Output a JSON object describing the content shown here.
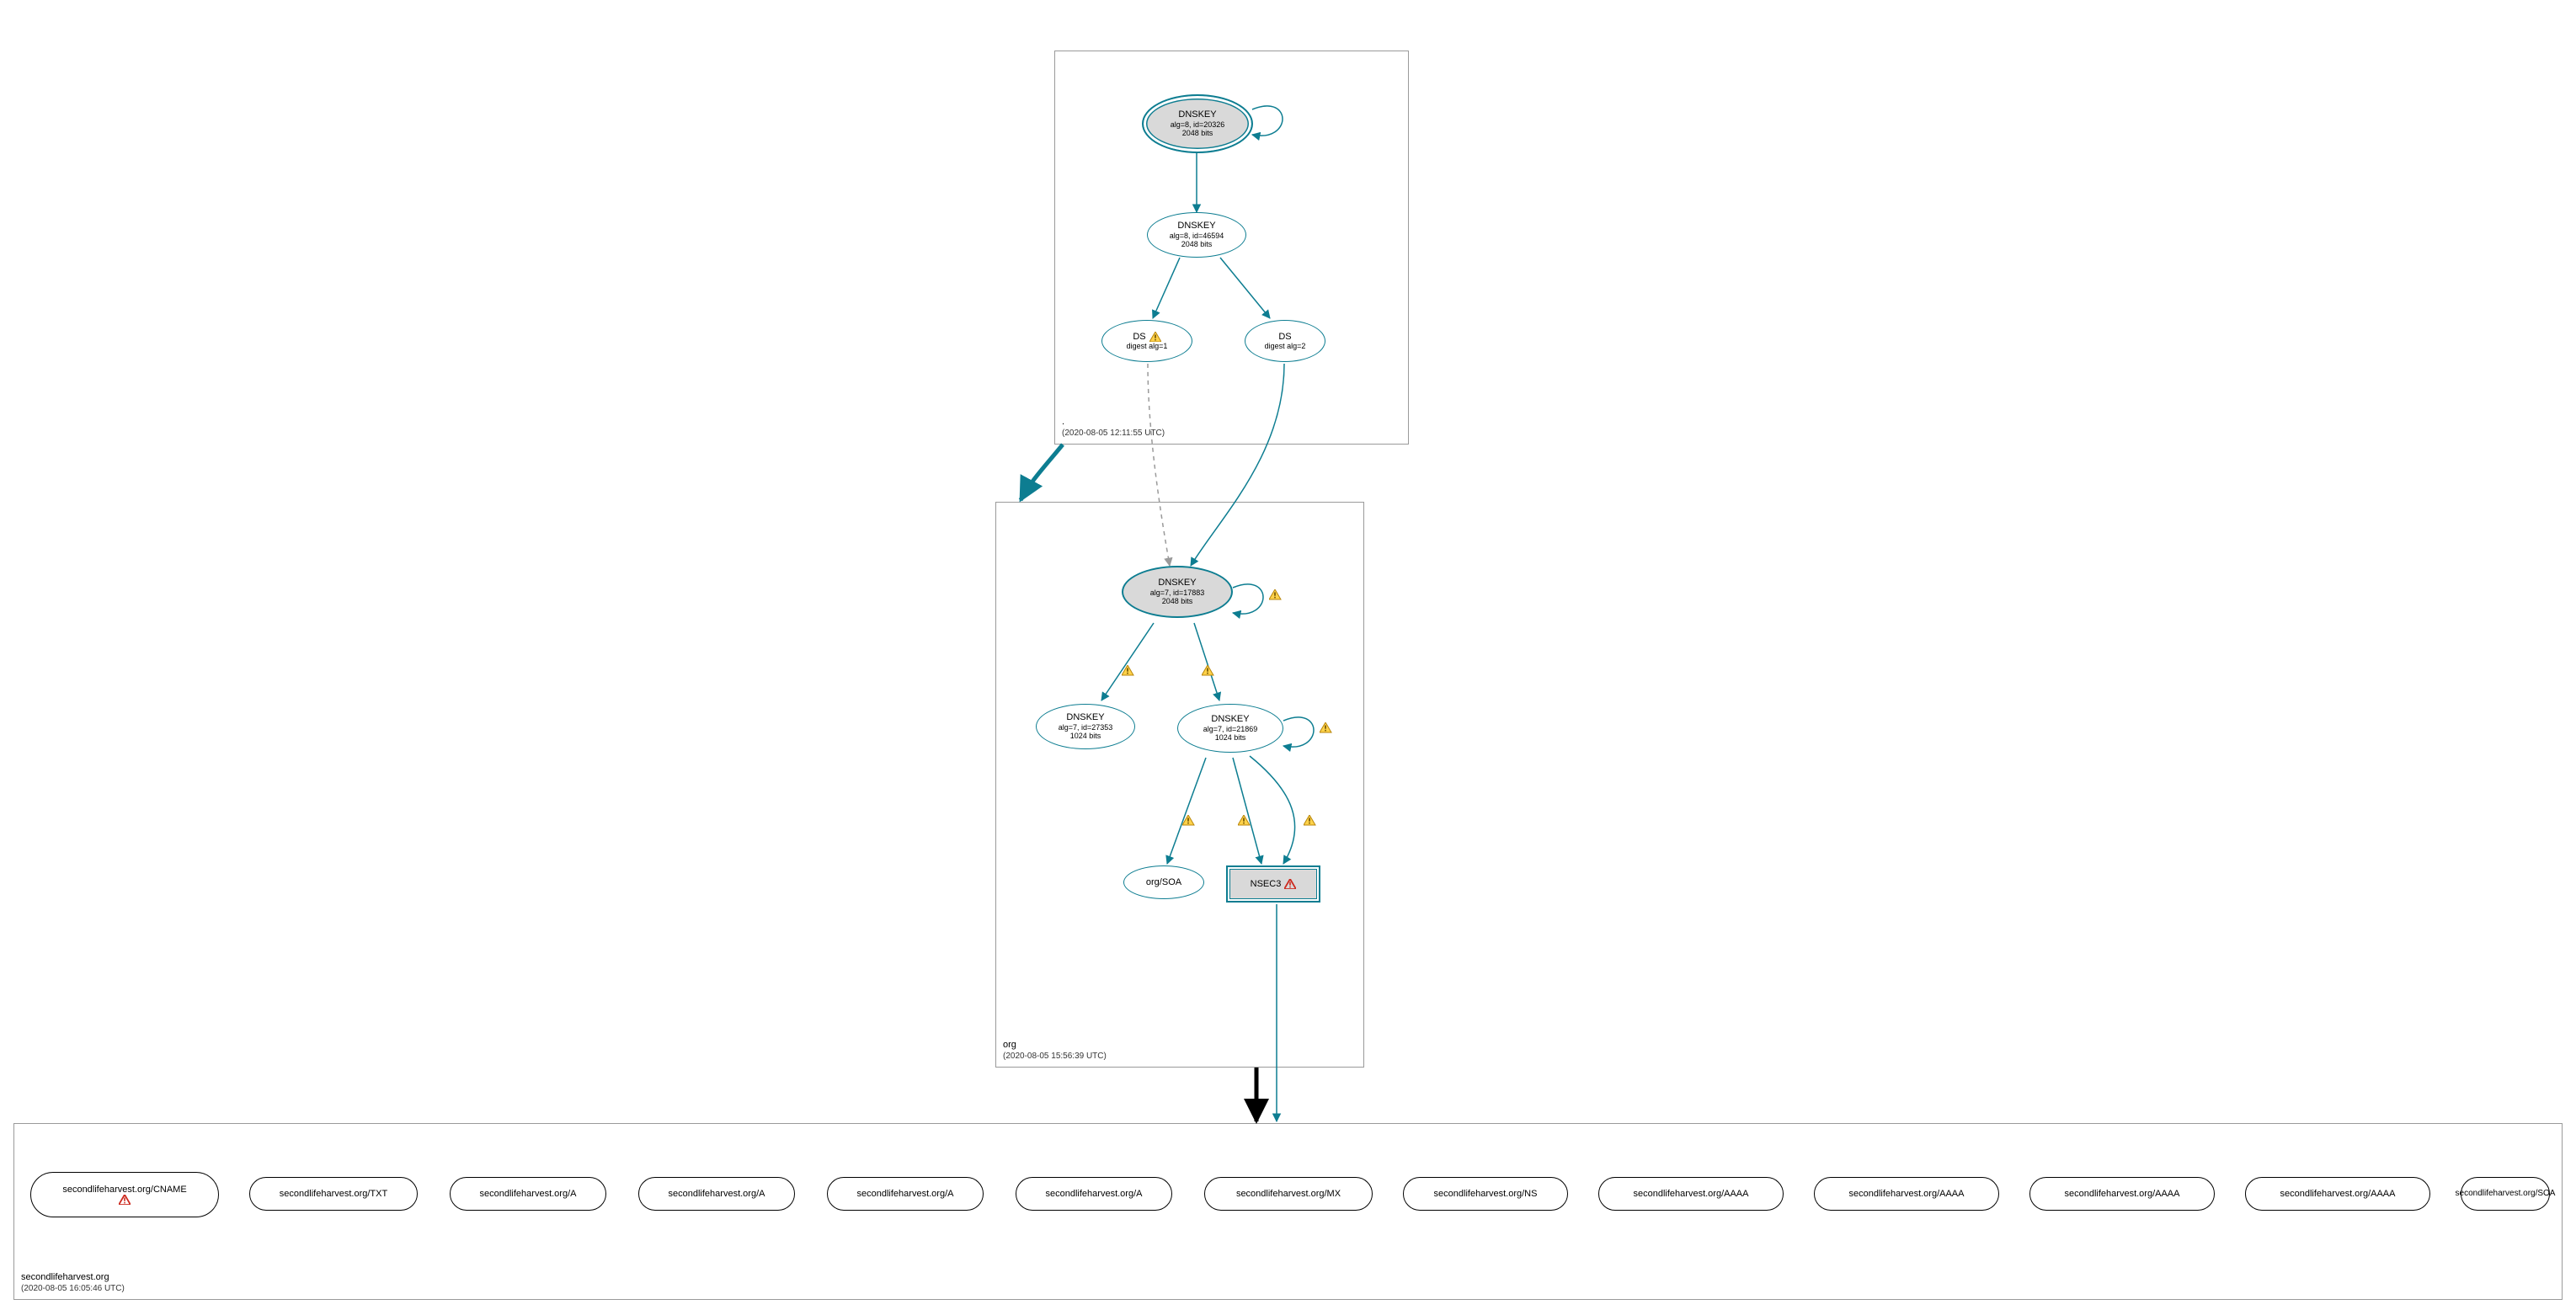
{
  "colors": {
    "teal": "#0d7d91",
    "grey_fill": "#d9d9d9"
  },
  "zones": {
    "root": {
      "name": ".",
      "timestamp": "(2020-08-05 12:11:55 UTC)"
    },
    "org": {
      "name": "org",
      "timestamp": "(2020-08-05 15:56:39 UTC)"
    },
    "leaf": {
      "name": "secondlifeharvest.org",
      "timestamp": "(2020-08-05 16:05:46 UTC)"
    }
  },
  "nodes": {
    "root_ksk": {
      "title": "DNSKEY",
      "sub1": "alg=8, id=20326",
      "sub2": "2048 bits"
    },
    "root_zsk": {
      "title": "DNSKEY",
      "sub1": "alg=8, id=46594",
      "sub2": "2048 bits"
    },
    "ds1": {
      "title": "DS",
      "sub1": "digest alg=1"
    },
    "ds2": {
      "title": "DS",
      "sub1": "digest alg=2"
    },
    "org_ksk": {
      "title": "DNSKEY",
      "sub1": "alg=7, id=17883",
      "sub2": "2048 bits"
    },
    "org_zsk_a": {
      "title": "DNSKEY",
      "sub1": "alg=7, id=27353",
      "sub2": "1024 bits"
    },
    "org_zsk_b": {
      "title": "DNSKEY",
      "sub1": "alg=7, id=21869",
      "sub2": "1024 bits"
    },
    "org_soa": {
      "title": "org/SOA"
    },
    "nsec3": {
      "title": "NSEC3"
    },
    "leaf_cname": {
      "title": "secondlifeharvest.org/CNAME"
    },
    "leaf_txt": {
      "title": "secondlifeharvest.org/TXT"
    },
    "leaf_a1": {
      "title": "secondlifeharvest.org/A"
    },
    "leaf_a2": {
      "title": "secondlifeharvest.org/A"
    },
    "leaf_a3": {
      "title": "secondlifeharvest.org/A"
    },
    "leaf_a4": {
      "title": "secondlifeharvest.org/A"
    },
    "leaf_mx": {
      "title": "secondlifeharvest.org/MX"
    },
    "leaf_ns": {
      "title": "secondlifeharvest.org/NS"
    },
    "leaf_aaaa1": {
      "title": "secondlifeharvest.org/AAAA"
    },
    "leaf_aaaa2": {
      "title": "secondlifeharvest.org/AAAA"
    },
    "leaf_aaaa3": {
      "title": "secondlifeharvest.org/AAAA"
    },
    "leaf_aaaa4": {
      "title": "secondlifeharvest.org/AAAA"
    },
    "leaf_soa": {
      "title": "secondlifeharvest.org/SOA"
    }
  },
  "edges_description": [
    "root_ksk self-loop",
    "root_ksk -> root_zsk",
    "root_zsk -> ds1",
    "root_zsk -> ds2",
    "ds1 -> org_ksk (dashed grey, warning)",
    "ds2 -> org_ksk (teal)",
    "root zone box -> org zone box (thick teal)",
    "org_ksk self-loop (warning)",
    "org_ksk -> org_zsk_a (warning)",
    "org_ksk -> org_zsk_b (warning)",
    "org_zsk_b self-loop (warning)",
    "org_zsk_b -> org_soa (warning)",
    "org_zsk_b -> nsec3 (warning, two arrows)",
    "nsec3 -> leaf zone box (teal)",
    "org zone box -> leaf zone box (thick black)"
  ]
}
